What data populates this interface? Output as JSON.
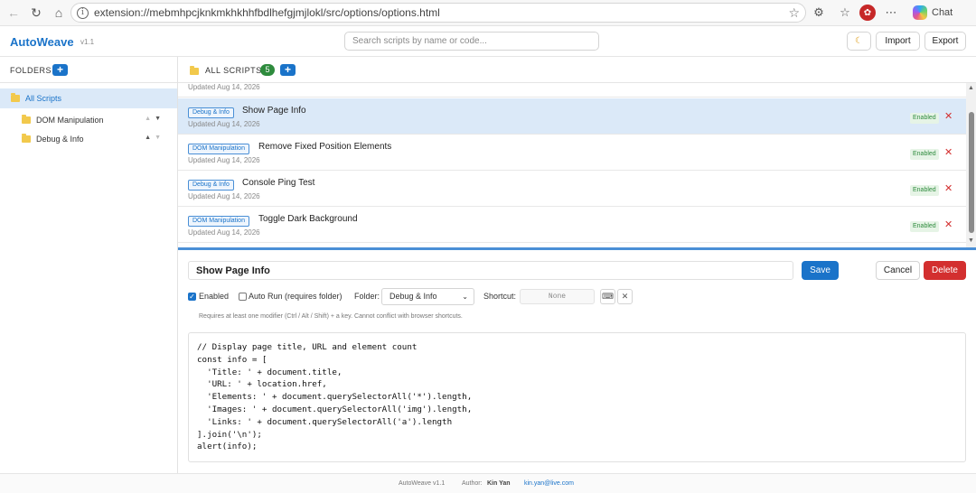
{
  "browser": {
    "url": "extension://mebmhpcjknkmkhkhhfbdlhefgjmjlokl/src/options/options.html",
    "chat_label": "Chat"
  },
  "header": {
    "brand": "AutoWeave",
    "version": "v1.1",
    "search_placeholder": "Search scripts by name or code...",
    "import_label": "Import",
    "export_label": "Export"
  },
  "sidebar": {
    "title": "FOLDERS",
    "add": "+",
    "all_label": "All Scripts",
    "folders": [
      {
        "label": "DOM Manipulation"
      },
      {
        "label": "Debug & Info"
      }
    ]
  },
  "list": {
    "title": "ALL SCRIPTS",
    "count": "5",
    "add": "+",
    "partial_updated": "Updated Aug 14, 2026",
    "rows": [
      {
        "tag": "Debug & Info",
        "name": "Show Page Info",
        "updated": "Updated Aug 14, 2026",
        "status": "Enabled",
        "delete": "✕"
      },
      {
        "tag": "DOM Manipulation",
        "name": "Remove Fixed Position Elements",
        "updated": "Updated Aug 14, 2026",
        "status": "Enabled",
        "delete": "✕"
      },
      {
        "tag": "Debug & Info",
        "name": "Console Ping Test",
        "updated": "Updated Aug 14, 2026",
        "status": "Enabled",
        "delete": "✕"
      },
      {
        "tag": "DOM Manipulation",
        "name": "Toggle Dark Background",
        "updated": "Updated Aug 14, 2026",
        "status": "Enabled",
        "delete": "✕"
      }
    ]
  },
  "editor": {
    "title_value": "Show Page Info",
    "save_label": "Save",
    "cancel_label": "Cancel",
    "delete_label": "Delete",
    "enabled_label": "Enabled",
    "enabled_checked": true,
    "autorun_label": "Auto Run (requires folder)",
    "autorun_checked": false,
    "folder_label": "Folder:",
    "folder_value": "Debug & Info",
    "shortcut_label": "Shortcut:",
    "shortcut_value": "None",
    "hint": "Requires at least one modifier (Ctrl / Alt / Shift) + a key. Cannot conflict with browser shortcuts.",
    "code": "// Display page title, URL and element count\nconst info = [\n  'Title: ' + document.title,\n  'URL: ' + location.href,\n  'Elements: ' + document.querySelectorAll('*').length,\n  'Images: ' + document.querySelectorAll('img').length,\n  'Links: ' + document.querySelectorAll('a').length\n].join('\\n');\nalert(info);"
  },
  "footer": {
    "app": "AutoWeave v1.1",
    "author_label": "Author:",
    "author_name": "Kin Yan",
    "email": "kin.yan@live.com"
  },
  "colors": {
    "accent": "#1a73c9",
    "danger": "#d32f2f",
    "success": "#2e8b3d",
    "selected_bg": "#dbe9f8"
  }
}
